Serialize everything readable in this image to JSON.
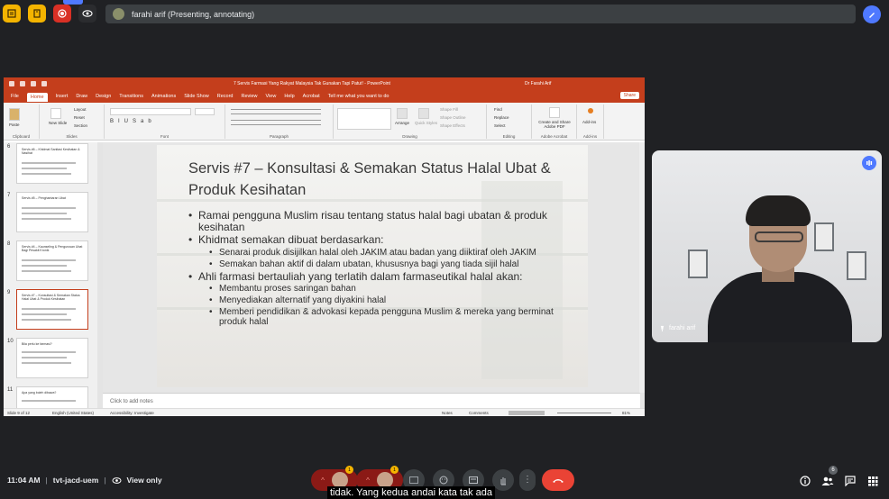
{
  "top_bar": {
    "presenting_text": "farahi arif (Presenting, annotating)",
    "icons": [
      "notes-icon",
      "doc-icon",
      "record-icon",
      "eye-icon"
    ],
    "colors": {
      "yellow": "#f4b400",
      "red": "#d93025",
      "blue": "#4f79ff"
    }
  },
  "ppt": {
    "window_title": "7 Servis Farmasi Yang Rakyat Malaysia Tak Gunakan Tapi Patut! - PowerPoint",
    "user_name": "Dr Farahi Arif",
    "tabs": [
      "File",
      "Home",
      "Insert",
      "Draw",
      "Design",
      "Transitions",
      "Animations",
      "Slide Show",
      "Record",
      "Review",
      "View",
      "Help",
      "Acrobat"
    ],
    "tell_me": "Tell me what you want to do",
    "share": "Share",
    "ribbon": {
      "clipboard": "Clipboard",
      "paste": "Paste",
      "new_slide": "New Slide",
      "layout": "Layout",
      "reset": "Reset",
      "section": "Section",
      "slides": "Slides",
      "font": "Font",
      "paragraph": "Paragraph",
      "drawing": "Drawing",
      "arrange": "Arrange",
      "quick_styles": "Quick Styles",
      "shape_fill": "Shape Fill",
      "shape_outline": "Shape Outline",
      "shape_effects": "Shape Effects",
      "find": "Find",
      "replace": "Replace",
      "select": "Select",
      "editing": "Editing",
      "create_share_pdf": "Create and Share Adobe PDF",
      "adobe_acrobat": "Adobe Acrobat",
      "add_ins": "Add-ins",
      "add_ins_group": "Add-ins"
    },
    "thumbnails": [
      {
        "num": "6",
        "title": "Servis #6 – Khidmat Sanitasi Kesihatan & Nasihat"
      },
      {
        "num": "7",
        "title": "Servis #5 – Penghantaran Ubat"
      },
      {
        "num": "8",
        "title": "Servis #4 – Kaunseling & Pengurusan Ubat Bagi Pesakit Kronik"
      },
      {
        "num": "9",
        "title": "Servis #7 – Konsultasi & Semakan Status Halal Ubat & Produk Kesihatan"
      },
      {
        "num": "10",
        "title": "Bila perlu ke farmasi?"
      },
      {
        "num": "11",
        "title": "Apa yang boleh dibawa?"
      }
    ],
    "slide": {
      "title": "Servis #7 – Konsultasi & Semakan Status Halal Ubat & Produk Kesihatan",
      "bullets": [
        {
          "text": "Ramai pengguna Muslim risau tentang status halal bagi ubatan & produk kesihatan",
          "sub": []
        },
        {
          "text": "Khidmat semakan dibuat berdasarkan:",
          "sub": [
            "Senarai produk disijilkan halal oleh JAKIM atau badan yang diiktiraf oleh JAKIM",
            "Semakan bahan aktif di dalam ubatan, khususnya bagi yang tiada sijil halal"
          ]
        },
        {
          "text": "Ahli farmasi bertauliah yang terlatih dalam farmaseutikal halal akan:",
          "sub": [
            "Membantu proses saringan bahan",
            "Menyediakan alternatif yang diyakini halal",
            "Memberi pendidikan & advokasi kepada pengguna Muslim & mereka yang berminat produk halal"
          ]
        }
      ]
    },
    "notes_placeholder": "Click to add notes",
    "status": {
      "slide_of": "Slide 9 of 12",
      "language": "English (United States)",
      "accessibility": "Accessibility: Investigate",
      "notes": "Notes",
      "comments": "Comments",
      "zoom": "81%"
    }
  },
  "video": {
    "name": "farahi arif"
  },
  "bottom_bar": {
    "time": "11:04 AM",
    "meeting_code": "tvt-jacd-uem",
    "view_mode": "View only",
    "caption": "tidak. Yang kedua andai kata tak ada",
    "people_count": "6",
    "badge_1": "1",
    "badge_2": "1"
  }
}
